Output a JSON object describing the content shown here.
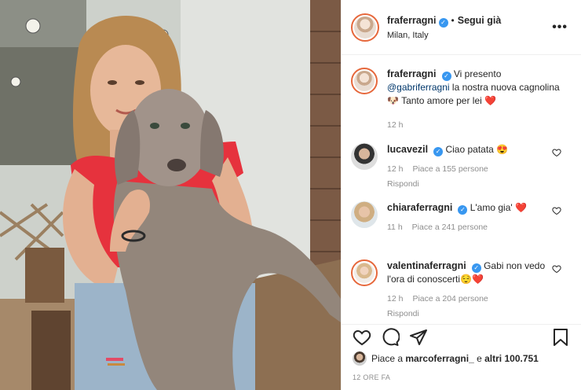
{
  "post": {
    "author": "fraferragni",
    "follow_label": "Segui già",
    "separator": "•",
    "location": "Milan, Italy",
    "more_icon": "more-options-icon"
  },
  "caption": {
    "author": "fraferragni",
    "text_before": "Vi presento",
    "mention": "@gabriferragni",
    "text_after": "la nostra nuova cagnolina",
    "emoji_dog": "🐶",
    "text_end": "Tanto amore per lei",
    "emoji_heart": "❤️",
    "time": "12 h"
  },
  "comments": [
    {
      "author": "lucavezil",
      "text": "Ciao patata 😍",
      "time": "12 h",
      "likes": "Piace a 155 persone",
      "reply": "Rispondi"
    },
    {
      "author": "chiaraferragni",
      "text": "L'amo gia' ❤️",
      "time": "11 h",
      "likes": "Piace a 241 persone",
      "reply": ""
    },
    {
      "author": "valentinaferragni",
      "text": "Gabi non vedo l'ora di conoscerti😌❤️",
      "time": "12 h",
      "likes": "Piace a 204 persone",
      "reply": "Rispondi"
    }
  ],
  "likes_line": {
    "prefix": "Piace a",
    "user": "marcoferragni_",
    "middle": "e",
    "count": "altri 100.751"
  },
  "timestamp": "12 ORE FA",
  "colors": {
    "verified": "#3897f0",
    "heart": "#ed4956",
    "meta": "#8e8e8e"
  }
}
